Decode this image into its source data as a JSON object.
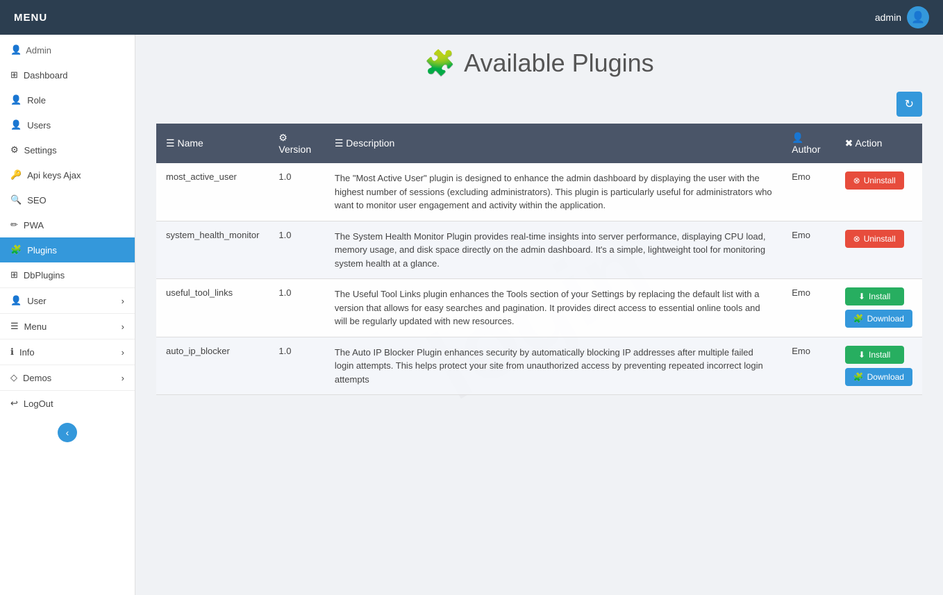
{
  "topbar": {
    "menu_label": "MENU",
    "user_label": "admin"
  },
  "sidebar": {
    "admin_label": "Admin",
    "items": [
      {
        "id": "dashboard",
        "label": "Dashboard",
        "icon": "⊞"
      },
      {
        "id": "role",
        "label": "Role",
        "icon": "👤"
      },
      {
        "id": "users",
        "label": "Users",
        "icon": "👤"
      },
      {
        "id": "settings",
        "label": "Settings",
        "icon": "⚙"
      },
      {
        "id": "api-keys-ajax",
        "label": "Api keys Ajax",
        "icon": "🔑"
      },
      {
        "id": "seo",
        "label": "SEO",
        "icon": "🔍"
      },
      {
        "id": "pwa",
        "label": "PWA",
        "icon": "✏"
      },
      {
        "id": "plugins",
        "label": "Plugins",
        "icon": "🧩",
        "active": true
      },
      {
        "id": "dbplugins",
        "label": "DbPlugins",
        "icon": "⊞"
      }
    ],
    "sections": [
      {
        "id": "user",
        "label": "User"
      },
      {
        "id": "menu",
        "label": "Menu"
      },
      {
        "id": "info",
        "label": "Info"
      },
      {
        "id": "demos",
        "label": "Demos"
      },
      {
        "id": "logout",
        "label": "LogOut"
      }
    ],
    "toggle_label": "‹"
  },
  "page": {
    "title": "Available Plugins",
    "puzzle_icon": "🧩",
    "refresh_icon": "↻"
  },
  "table": {
    "columns": [
      {
        "id": "name",
        "label": "Name",
        "icon": "☰"
      },
      {
        "id": "version",
        "label": "Version",
        "icon": "⚙"
      },
      {
        "id": "description",
        "label": "Description",
        "icon": "☰"
      },
      {
        "id": "author",
        "label": "Author",
        "icon": "👤"
      },
      {
        "id": "action",
        "label": "Action",
        "icon": "✖"
      }
    ],
    "plugins": [
      {
        "name": "most_active_user",
        "version": "1.0",
        "description": "The \"Most Active User\" plugin is designed to enhance the admin dashboard by displaying the user with the highest number of sessions (excluding administrators). This plugin is particularly useful for administrators who want to monitor user engagement and activity within the application.",
        "author": "Emo",
        "status": "installed",
        "uninstall_label": "Uninstall"
      },
      {
        "name": "system_health_monitor",
        "version": "1.0",
        "description": "The System Health Monitor Plugin provides real-time insights into server performance, displaying CPU load, memory usage, and disk space directly on the admin dashboard. It's a simple, lightweight tool for monitoring system health at a glance.",
        "author": "Emo",
        "status": "installed",
        "uninstall_label": "Uninstall"
      },
      {
        "name": "useful_tool_links",
        "version": "1.0",
        "description": "The Useful Tool Links plugin enhances the Tools section of your Settings by replacing the default list with a version that allows for easy searches and pagination. It provides direct access to essential online tools and will be regularly updated with new resources.",
        "author": "Emo",
        "status": "available",
        "install_label": "Install",
        "download_label": "Download"
      },
      {
        "name": "auto_ip_blocker",
        "version": "1.0",
        "description": "The Auto IP Blocker Plugin enhances security by automatically blocking IP addresses after multiple failed login attempts. This helps protect your site from unauthorized access by preventing repeated incorrect login attempts",
        "author": "Emo",
        "status": "available",
        "install_label": "Install",
        "download_label": "Download"
      }
    ]
  },
  "watermark": {
    "text": "login"
  },
  "colors": {
    "primary": "#3498db",
    "danger": "#e74c3c",
    "success": "#27ae60",
    "topbar_bg": "#2c3e50",
    "table_header_bg": "#4a5568"
  }
}
